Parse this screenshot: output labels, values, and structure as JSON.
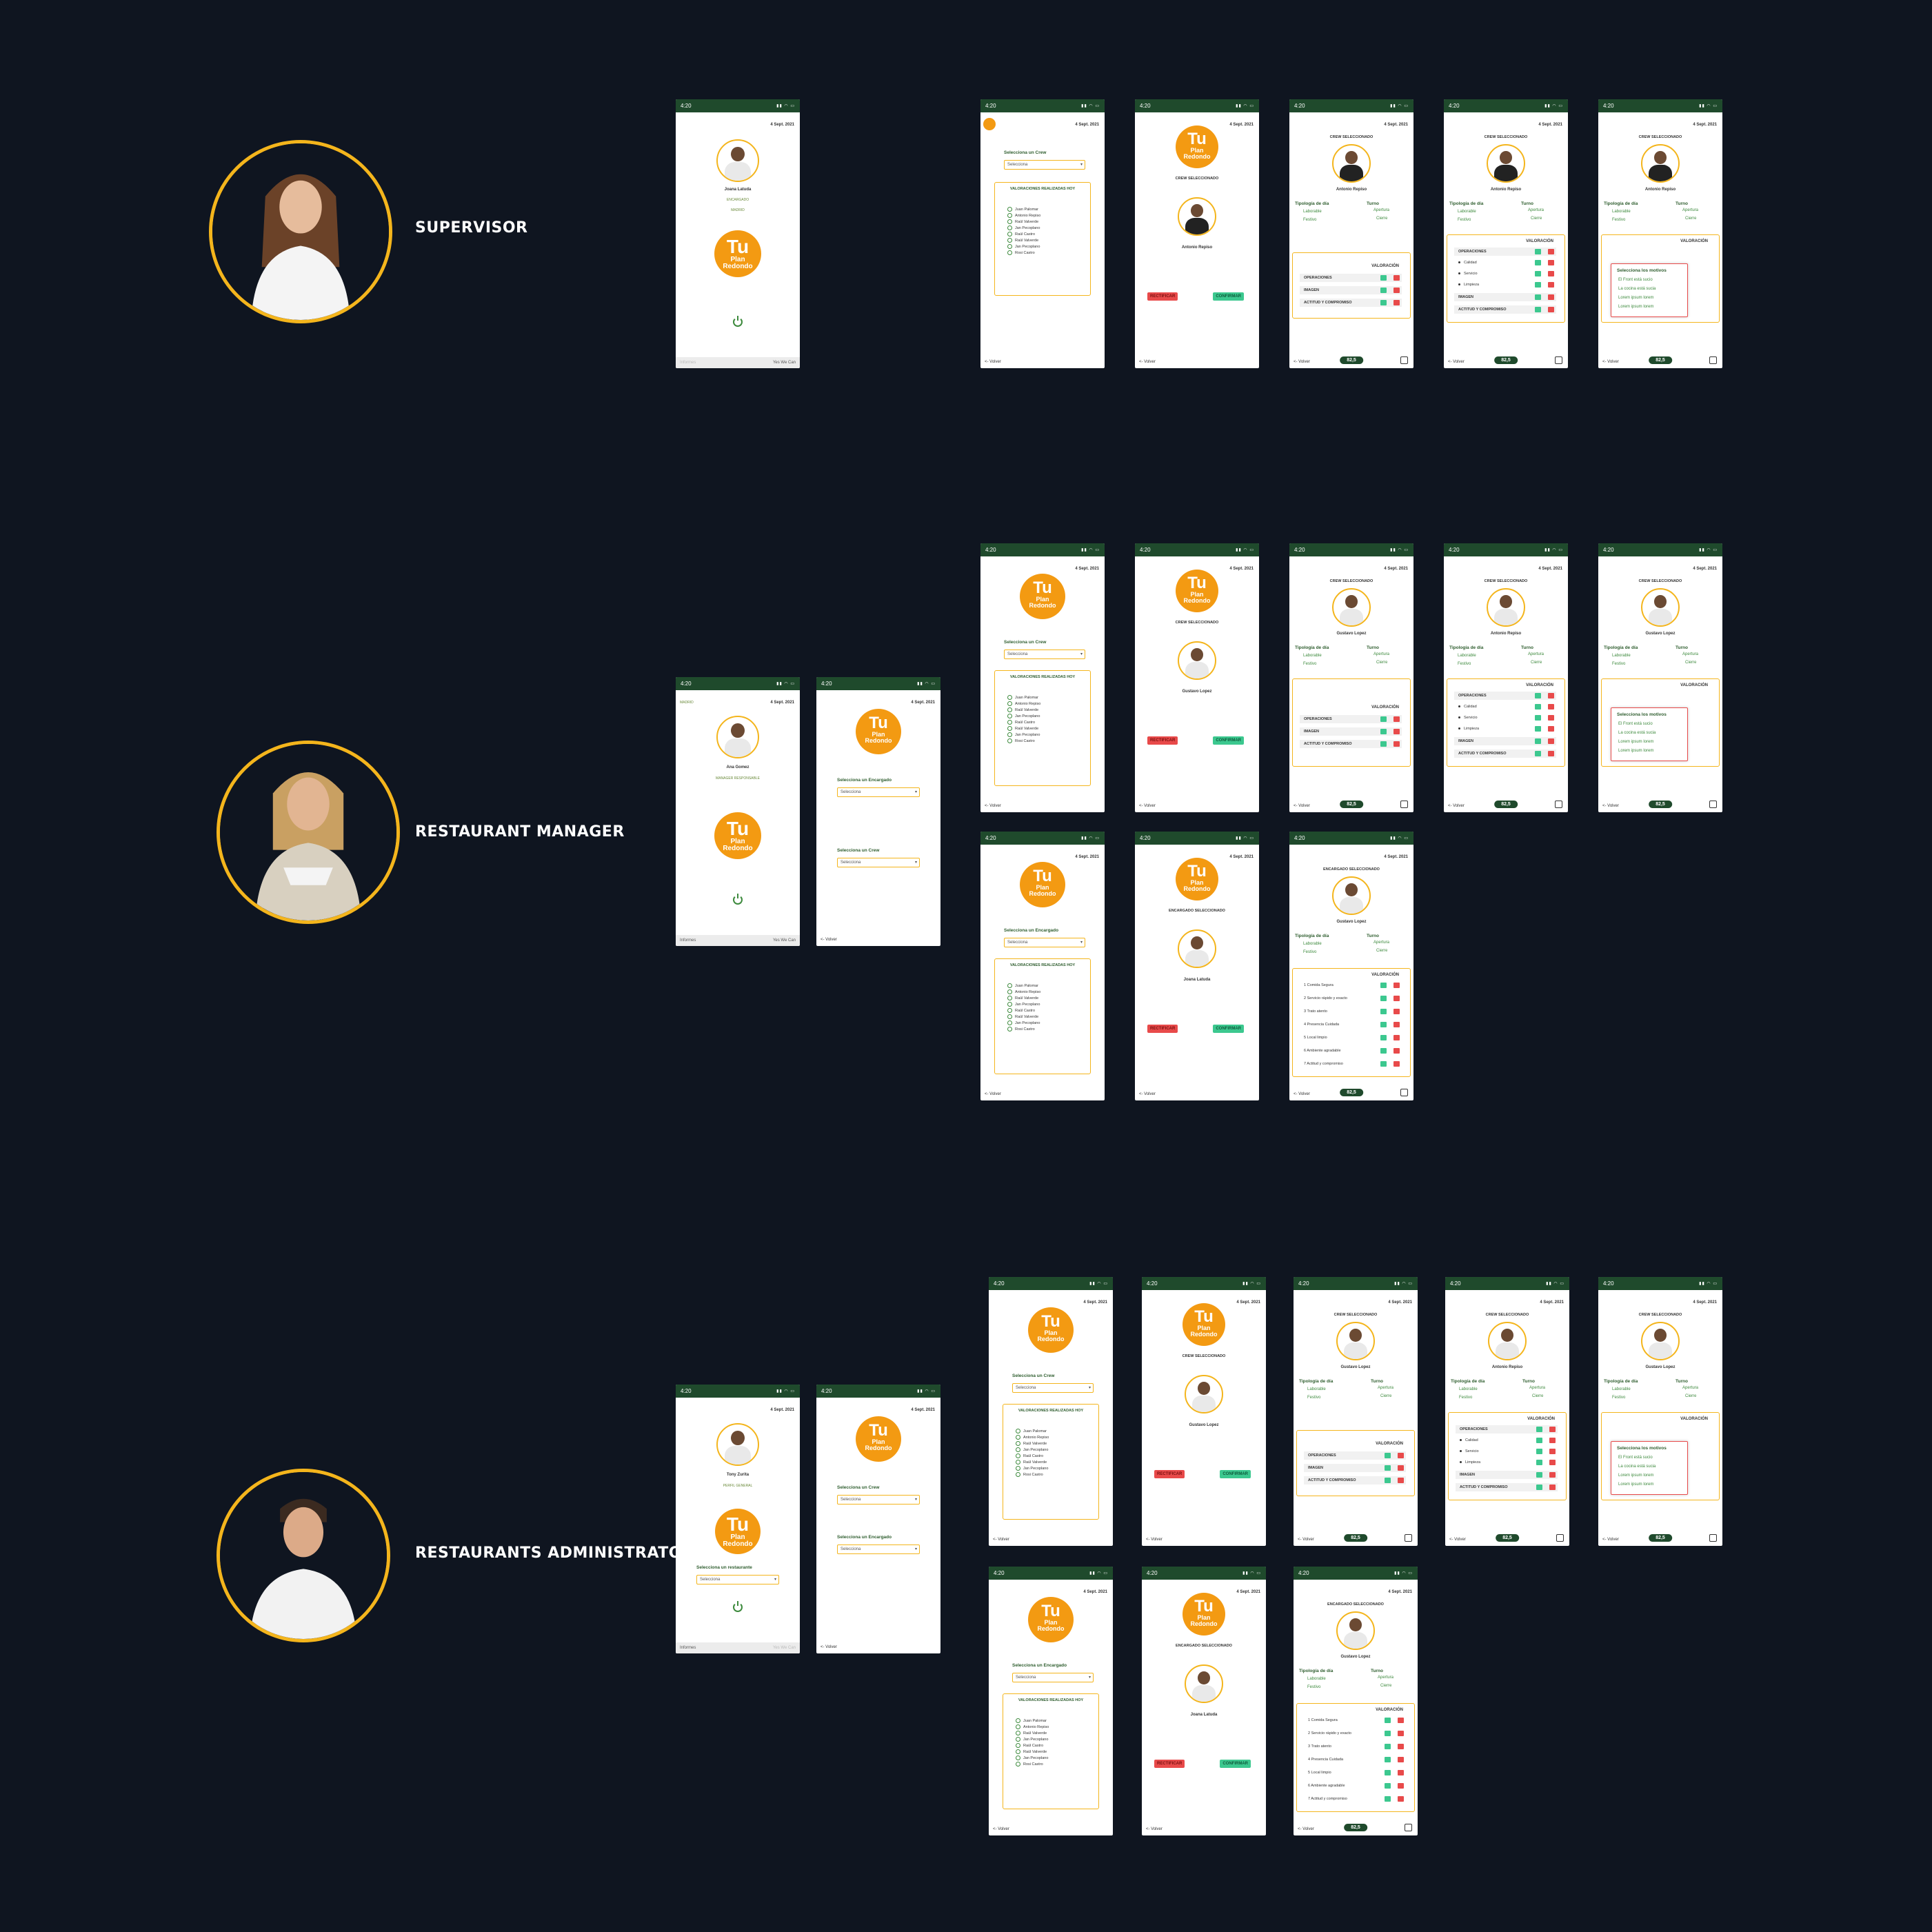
{
  "personas": [
    {
      "role": "SUPERVISOR"
    },
    {
      "role": "RESTAURANT MANAGER"
    },
    {
      "role": "RESTAURANTS ADMINISTRATOR"
    }
  ],
  "app": {
    "status_time": "4:20",
    "date": "4 Sept. 2021",
    "logo_tu": "Tu",
    "logo_plan": "Plan",
    "logo_redondo": "Redondo",
    "back": "<- Volver",
    "score": "82,5",
    "select_placeholder": "Selecciona",
    "select_crew": "Selecciona un Crew",
    "select_encargado": "Selecciona un Encargado",
    "select_restaurante": "Selecciona un restaurante",
    "valoraciones_title": "VALORACIONES REALIZADAS HOY",
    "crew_seleccionado": "CREW SELECCIONADO",
    "encargado_seleccionado": "ENCARGADO SELECCIONADO",
    "btn_rectificar": "RECTIFICAR",
    "btn_confirmar": "CONFIRMAR",
    "tipologia": "Tipología de día",
    "turno": "Turno",
    "laborable": "Laborable",
    "festivo": "Festivo",
    "apertura": "Apertura",
    "cierre": "Cierre",
    "valoracion": "VALORACIÓN",
    "informes": "Informes",
    "yes_we_can": "Yes We Can",
    "valoraciones_list": [
      "Juan Palomar",
      "Antonio Repiso",
      "Raúl Valverde",
      "Jan Pecoplano",
      "Raúl Castro",
      "Raúl Valverde",
      "Jan Pecoplano",
      "Rosi Castro"
    ],
    "valoracion_rows": [
      "OPERACIONES",
      "IMAGEN",
      "ACTITUD Y COMPROMISO"
    ],
    "operaciones_expanded": [
      "OPERACIONES",
      "Calidad",
      "Servicio",
      "Limpieza",
      "IMAGEN",
      "ACTITUD Y COMPROMISO"
    ],
    "encargado_rows": [
      "Comida Segura",
      "Servicio rápido y exacto",
      "Trato atento",
      "Presencia Cuidada",
      "Local limpio",
      "Ambiente agradable",
      "Actitud y compromiso"
    ],
    "motivos_title": "Selecciona los motivos",
    "motivos": [
      "El Front está sucio",
      "La cocina está sucia",
      "Lorem ipsum lorem",
      "Lorem ipsum lorem"
    ]
  },
  "people": {
    "supervisor_user": "Joana Latuda",
    "supervisor_role": "ENCARGADO",
    "supervisor_store": "MADRID",
    "antonio": "Antonio Repiso",
    "gustavo": "Gustavo Lopez",
    "joana": "Joana Latuda",
    "manager_user": "Ana Gomez",
    "manager_role": "MANAGER RESPONSABLE",
    "manager_store": "MADRID",
    "admin_user": "Tony Zurita",
    "admin_role": "PERFIL GENERAL"
  }
}
